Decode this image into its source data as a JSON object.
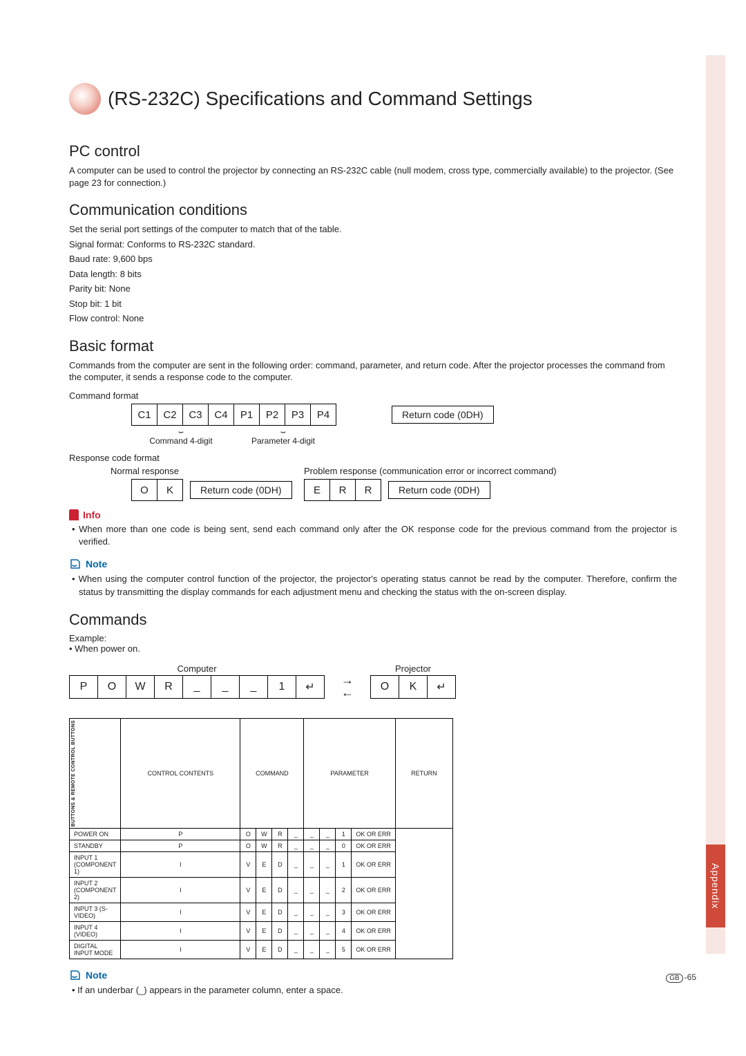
{
  "page_title": "(RS-232C) Specifications and Command Settings",
  "side_tab": "Appendix",
  "page_number": "65",
  "pc_control": {
    "heading": "PC control",
    "body": "A computer can be used to control the projector by connecting an RS-232C cable (null modem, cross type, commercially available) to the projector. (See page 23 for connection.)"
  },
  "comm_conditions": {
    "heading": "Communication conditions",
    "lines": [
      "Set the serial port settings of the computer to match that of the table.",
      "Signal format: Conforms to RS-232C standard.",
      "Baud rate: 9,600 bps",
      "Data length: 8 bits",
      "Parity bit: None",
      "Stop bit: 1 bit",
      "Flow control: None"
    ]
  },
  "basic_format": {
    "heading": "Basic format",
    "body": "Commands from the computer are sent in the following order: command, parameter, and return code. After the projector processes the command from the computer, it sends a response code to the computer.",
    "command_format_label": "Command format",
    "command_cells": [
      "C1",
      "C2",
      "C3",
      "C4",
      "P1",
      "P2",
      "P3",
      "P4"
    ],
    "command4": "Command 4-digit",
    "param4": "Parameter 4-digit",
    "return_code": "Return code (0DH)",
    "response_label": "Response code format",
    "normal_response": "Normal response",
    "ok_cells": [
      "O",
      "K"
    ],
    "problem_response": "Problem response (communication error or incorrect command)",
    "err_cells": [
      "E",
      "R",
      "R"
    ]
  },
  "info": {
    "label": "Info",
    "text": "• When more than one code is being sent, send each command only after the OK response code for the previous command from the projector is verified."
  },
  "note1": {
    "label": "Note",
    "text": "• When using the computer control function of the projector, the projector's operating status cannot be read by the computer. Therefore, confirm the status by transmitting the display commands for each adjustment menu and checking the status with the on-screen display."
  },
  "commands": {
    "heading": "Commands",
    "example": "Example:",
    "when": "• When power on.",
    "computer_label": "Computer",
    "projector_label": "Projector",
    "send_cells": [
      "P",
      "O",
      "W",
      "R",
      "_",
      "_",
      "_",
      "1",
      "↵"
    ],
    "resp_cells": [
      "O",
      "K",
      "↵"
    ]
  },
  "table": {
    "group_label": "BUTTONS & REMOTE CONTROL BUTTONS",
    "headers": {
      "c1": "CONTROL CONTENTS",
      "c2": "COMMAND",
      "c3": "PARAMETER",
      "c4": "RETURN"
    },
    "rows": [
      {
        "name": "POWER ON",
        "cmd": [
          "P",
          "O",
          "W",
          "R"
        ],
        "param": [
          "_",
          "_",
          "_",
          "1"
        ],
        "ret": "OK OR ERR"
      },
      {
        "name": "STANDBY",
        "cmd": [
          "P",
          "O",
          "W",
          "R"
        ],
        "param": [
          "_",
          "_",
          "_",
          "0"
        ],
        "ret": "OK OR ERR"
      },
      {
        "name": "INPUT 1 (COMPONENT 1)",
        "cmd": [
          "I",
          "V",
          "E",
          "D"
        ],
        "param": [
          "_",
          "_",
          "_",
          "1"
        ],
        "ret": "OK OR ERR"
      },
      {
        "name": "INPUT 2 (COMPONENT 2)",
        "cmd": [
          "I",
          "V",
          "E",
          "D"
        ],
        "param": [
          "_",
          "_",
          "_",
          "2"
        ],
        "ret": "OK OR ERR"
      },
      {
        "name": "INPUT 3 (S-VIDEO)",
        "cmd": [
          "I",
          "V",
          "E",
          "D"
        ],
        "param": [
          "_",
          "_",
          "_",
          "3"
        ],
        "ret": "OK OR ERR"
      },
      {
        "name": "INPUT 4 (VIDEO)",
        "cmd": [
          "I",
          "V",
          "E",
          "D"
        ],
        "param": [
          "_",
          "_",
          "_",
          "4"
        ],
        "ret": "OK OR ERR"
      },
      {
        "name": "DIGITAL INPUT MODE",
        "cmd": [
          "I",
          "V",
          "E",
          "D"
        ],
        "param": [
          "_",
          "_",
          "_",
          "5"
        ],
        "ret": "OK OR ERR"
      }
    ]
  },
  "note2": {
    "label": "Note",
    "text": "• If an underbar (_)  appears in the parameter column, enter a space."
  }
}
